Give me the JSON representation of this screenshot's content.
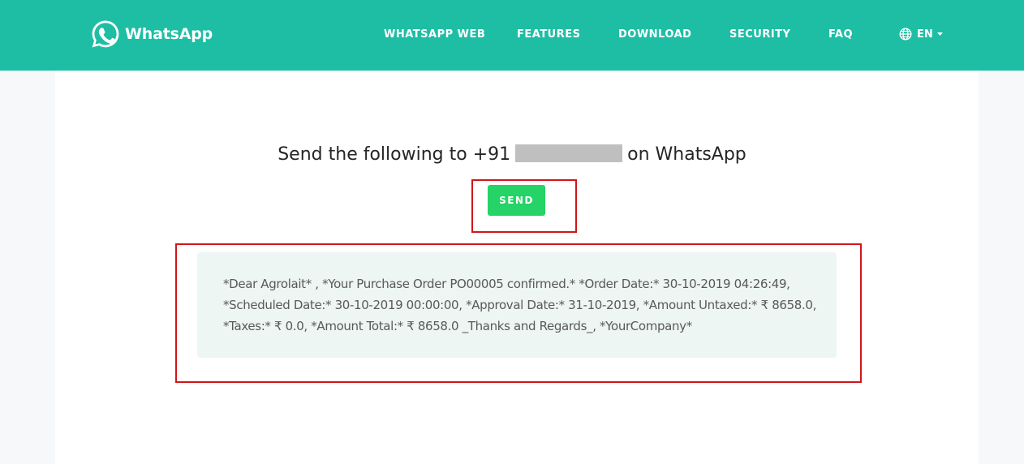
{
  "brand": {
    "name": "WhatsApp",
    "color": "#1ebea5",
    "accent": "#25d366"
  },
  "nav": {
    "whatsapp_web": "WHATSAPP WEB",
    "features": "FEATURES",
    "download": "DOWNLOAD",
    "security": "SECURITY",
    "faq": "FAQ",
    "language": "EN"
  },
  "icons": {
    "logo": "whatsapp-logo-icon",
    "language": "globe-icon",
    "dropdown": "caret-down-icon"
  },
  "main": {
    "title_prefix": "Send the following to +91",
    "title_suffix": "on WhatsApp",
    "send_label": "SEND",
    "message_lines": [
      "*Dear Agrolait* , *Your Purchase Order PO00005 confirmed.* *Order Date:* 30-10-2019 04:26:49,",
      "*Scheduled Date:* 30-10-2019 00:00:00, *Approval Date:* 31-10-2019, *Amount Untaxed:* ₹ 8658.0,",
      "*Taxes:* ₹ 0.0, *Amount Total:* ₹ 8658.0 _Thanks and Regards_, *YourCompany*"
    ]
  },
  "annotations": {
    "highlight_color": "#d0161a"
  }
}
